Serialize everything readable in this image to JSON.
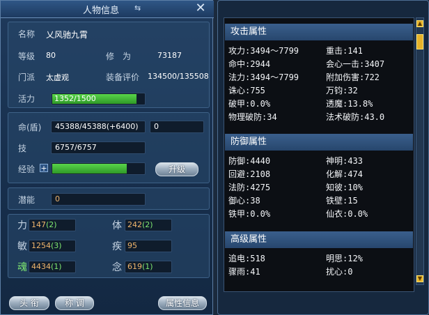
{
  "left": {
    "title": "人物信息",
    "title_glyph": "⇆",
    "close_glyph": "✕",
    "name_label": "名称",
    "name_value": "乂风驰九霄",
    "level_label": "等级",
    "level_value": "80",
    "cultivation_label": "修　为",
    "cultivation_value": "73187",
    "sect_label": "门派",
    "sect_value": "太虚观",
    "gear_label": "装备评价",
    "gear_value": "134500/135508",
    "vitality_label": "活力",
    "vitality_value": "1352/1500",
    "vitality_fraction": 0.9,
    "hp_label": "命(盾)",
    "hp_value": "45388/45388(+6400)",
    "shield_value": "0",
    "skill_label": "技",
    "skill_value": "6757/6757",
    "exp_label": "经验",
    "exp_plus": "+",
    "exp_fraction": 0.8,
    "upgrade_button": "升级",
    "potential_label": "潜能",
    "potential_value": "0",
    "stats": [
      {
        "label": "力",
        "base": "147",
        "bonus": "(2)"
      },
      {
        "label": "体",
        "base": "242",
        "bonus": "(2)"
      },
      {
        "label": "敏",
        "base": "1254",
        "bonus": "(3)"
      },
      {
        "label": "疾",
        "base": "95",
        "bonus": ""
      },
      {
        "label": "魂",
        "base": "4434",
        "bonus": "(1)"
      },
      {
        "label": "念",
        "base": "619",
        "bonus": "(1)"
      }
    ],
    "buttons": {
      "title_btn": "头 衔",
      "appellation_btn": "称 调",
      "attr_btn": "属性信息"
    }
  },
  "right": {
    "attack_header": "攻击属性",
    "attack": [
      {
        "label": "攻力:3494～7799"
      },
      {
        "label": "重击:141"
      },
      {
        "label": "命中:2944"
      },
      {
        "label": "会心一击:3407"
      },
      {
        "label": "法力:3494～7799"
      },
      {
        "label": "附加伤害:722"
      },
      {
        "label": "诛心:755"
      },
      {
        "label": "万钧:32"
      },
      {
        "label": "破甲:0.0%"
      },
      {
        "label": "透魔:13.8%"
      },
      {
        "label": "物理破防:34"
      },
      {
        "label": "法术破防:43.0"
      }
    ],
    "defense_header": "防御属性",
    "defense": [
      {
        "label": "防御:4440"
      },
      {
        "label": "神明:433"
      },
      {
        "label": "回避:2108"
      },
      {
        "label": "化解:474"
      },
      {
        "label": "法防:4275"
      },
      {
        "label": "知彼:10%"
      },
      {
        "label": "御心:38"
      },
      {
        "label": "铁壁:15"
      },
      {
        "label": "铁甲:0.0%"
      },
      {
        "label": "仙衣:0.0%"
      }
    ],
    "advanced_header": "高级属性",
    "advanced": [
      {
        "label": "追电:518"
      },
      {
        "label": "明思:12%"
      },
      {
        "label": "骤雨:41"
      },
      {
        "label": "扰心:0"
      }
    ]
  }
}
